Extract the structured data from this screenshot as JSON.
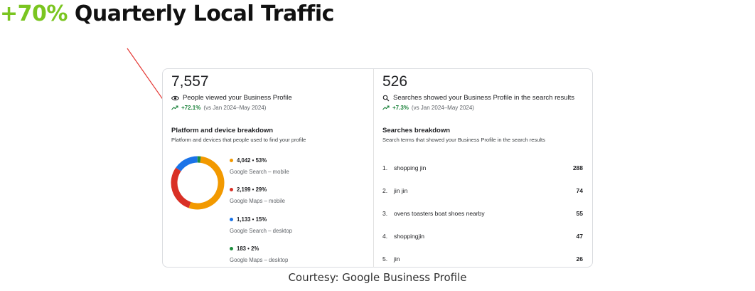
{
  "headline": {
    "percent": "+70%",
    "rest": "Quarterly Local Traffic"
  },
  "colors": {
    "accent_green": "#7ac520",
    "trend_green": "#188038",
    "pointer_red": "#e53935"
  },
  "views_panel": {
    "metric": "7,557",
    "label": "People viewed your Business Profile",
    "icon": "eye-icon",
    "change": "+72.1%",
    "comparison": "(vs Jan 2024–May 2024)",
    "breakdown_title": "Platform and device breakdown",
    "breakdown_subtitle": "Platform and devices that people used to find your profile",
    "segments": [
      {
        "value": "4,042 • 53%",
        "label": "Google Search – mobile",
        "color": "#f29900",
        "share": 53
      },
      {
        "value": "2,199 • 29%",
        "label": "Google Maps – mobile",
        "color": "#d93025",
        "share": 29
      },
      {
        "value": "1,133 • 15%",
        "label": "Google Search – desktop",
        "color": "#1a73e8",
        "share": 15
      },
      {
        "value": "183 • 2%",
        "label": "Google Maps – desktop",
        "color": "#1e8e3e",
        "share": 2
      }
    ]
  },
  "search_panel": {
    "metric": "526",
    "label": "Searches showed your Business Profile in the search results",
    "icon": "search-icon",
    "change": "+7.3%",
    "comparison": "(vs Jan 2024–May 2024)",
    "breakdown_title": "Searches breakdown",
    "breakdown_subtitle": "Search terms that showed your Business Profile in the search results",
    "terms": [
      {
        "rank": "1.",
        "term": "shopping jin",
        "count": "288"
      },
      {
        "rank": "2.",
        "term": "jin jin",
        "count": "74"
      },
      {
        "rank": "3.",
        "term": "ovens toasters boat shoes nearby",
        "count": "55"
      },
      {
        "rank": "4.",
        "term": "shoppingjin",
        "count": "47"
      },
      {
        "rank": "5.",
        "term": "jin",
        "count": "26"
      }
    ]
  },
  "courtesy": "Courtesy: Google Business Profile"
}
